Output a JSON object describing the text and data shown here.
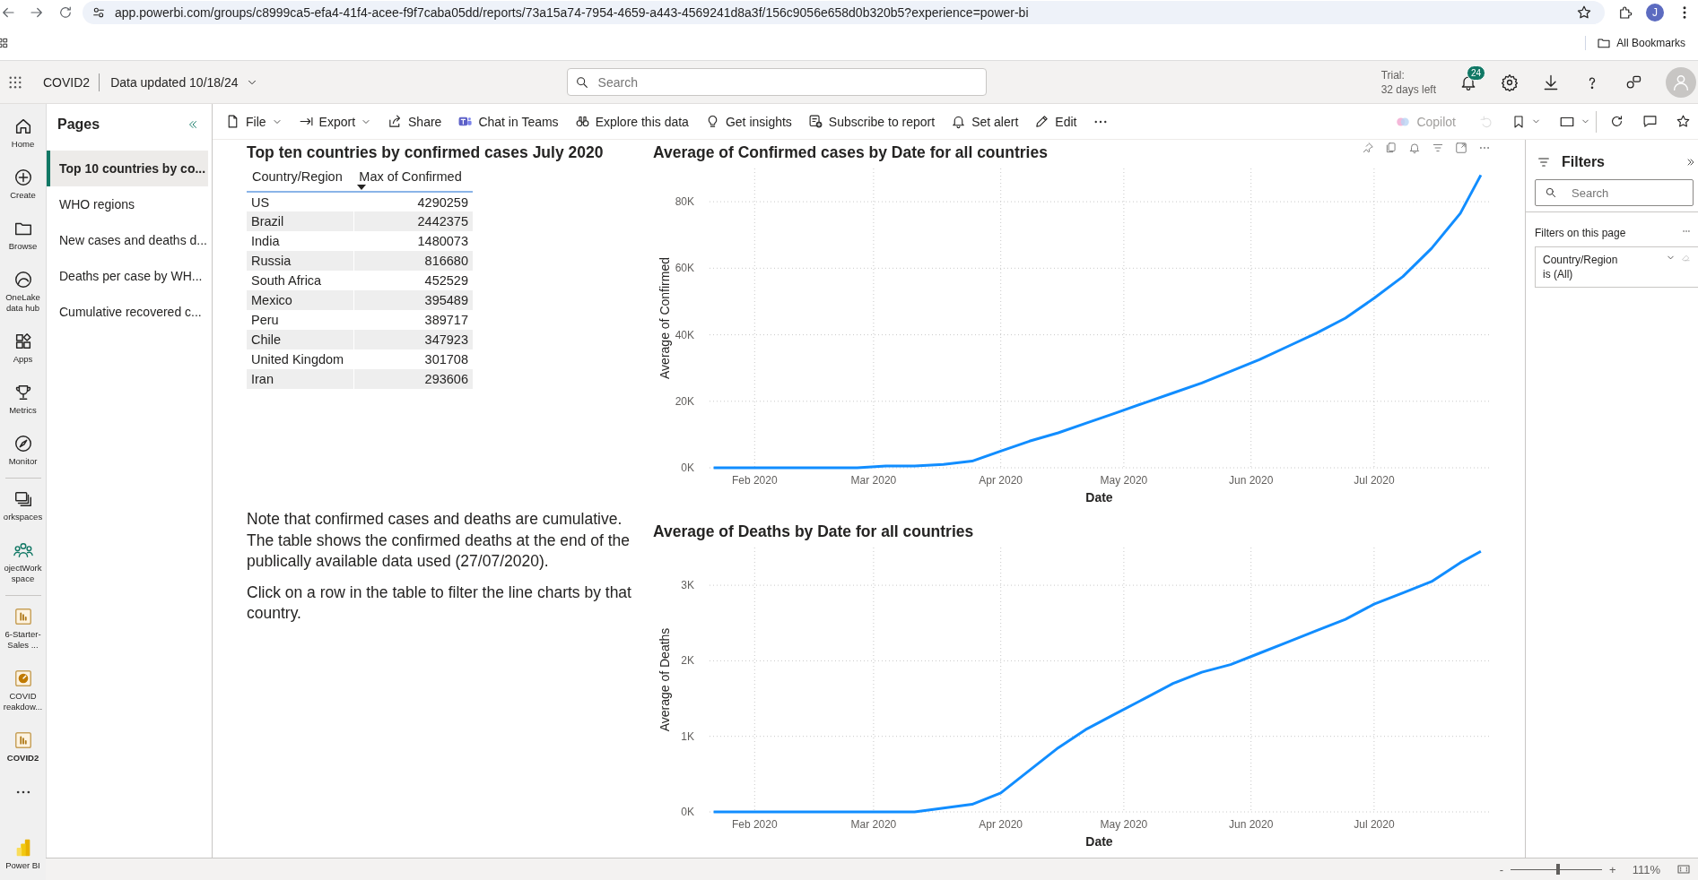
{
  "browser": {
    "url": "app.powerbi.com/groups/c8999ca5-efa4-41f4-acee-f9f7caba05dd/reports/73a15a74-7954-4659-a443-4569241d8a3f/156c9056e658d0b320b5?experience=power-bi",
    "profile_initial": "J",
    "bookmarks": "All Bookmarks"
  },
  "header": {
    "workspace": "COVID2",
    "data_updated": "Data updated 10/18/24",
    "search": {
      "placeholder": "Search"
    },
    "trial": "Trial:",
    "days_left": "32 days left",
    "notifications": "24"
  },
  "nav_rail": {
    "items": [
      {
        "label": "Home"
      },
      {
        "label": "Create"
      },
      {
        "label": "Browse"
      },
      {
        "label": "OneLake data hub"
      },
      {
        "label": "Apps"
      },
      {
        "label": "Metrics"
      },
      {
        "label": "Monitor"
      }
    ],
    "workspaces": [
      {
        "label": "orkspaces"
      },
      {
        "label": "ojectWork space"
      }
    ],
    "recent": [
      {
        "label": "6-Starter-Sales ...",
        "selected": false
      },
      {
        "label": "COVID reakdow...",
        "selected": false
      },
      {
        "label": "COVID2",
        "selected": true
      }
    ],
    "product": "Power BI"
  },
  "pages": {
    "title": "Pages",
    "items": [
      {
        "label": "Top 10 countries by co...",
        "selected": true
      },
      {
        "label": "WHO regions",
        "selected": false
      },
      {
        "label": "New cases and deaths d...",
        "selected": false
      },
      {
        "label": "Deaths per case by WH...",
        "selected": false
      },
      {
        "label": "Cumulative recovered c...",
        "selected": false
      }
    ]
  },
  "toolbar": {
    "items": [
      {
        "label": "File",
        "has_menu": true
      },
      {
        "label": "Export",
        "has_menu": true
      },
      {
        "label": "Share",
        "has_menu": false
      },
      {
        "label": "Chat in Teams",
        "has_menu": false
      },
      {
        "label": "Explore this data",
        "has_menu": false
      },
      {
        "label": "Get insights",
        "has_menu": false
      },
      {
        "label": "Subscribe to report",
        "has_menu": false
      },
      {
        "label": "Set alert",
        "has_menu": false
      },
      {
        "label": "Edit",
        "has_menu": false
      }
    ],
    "copilot": {
      "label": "Copilot",
      "disabled": true
    }
  },
  "table": {
    "title": "Top ten countries by confirmed cases July 2020",
    "columns": [
      {
        "label": "Country/Region",
        "sorted": false
      },
      {
        "label": "Max of Confirmed",
        "sorted": true
      }
    ],
    "rows": [
      [
        "US",
        "4290259"
      ],
      [
        "Brazil",
        "2442375"
      ],
      [
        "India",
        "1480073"
      ],
      [
        "Russia",
        "816680"
      ],
      [
        "South Africa",
        "452529"
      ],
      [
        "Mexico",
        "395489"
      ],
      [
        "Peru",
        "389717"
      ],
      [
        "Chile",
        "347923"
      ],
      [
        "United Kingdom",
        "301708"
      ],
      [
        "Iran",
        "293606"
      ]
    ]
  },
  "notes": [
    "Note that confirmed cases and deaths are cumulative. The table shows the confirmed deaths at the end of the publically available data used (27/07/2020).",
    "Click on a row in the table to filter the line charts by that country."
  ],
  "charts": [
    {
      "focused": true,
      "chart_data": {
        "type": "line",
        "title": "Average of Confirmed cases by Date for all countries",
        "xlabel": "Date",
        "ylabel": "Average of Confirmed",
        "x": [
          "2020-01-22",
          "2020-01-29",
          "2020-02-05",
          "2020-02-12",
          "2020-02-19",
          "2020-02-26",
          "2020-03-04",
          "2020-03-11",
          "2020-03-18",
          "2020-03-25",
          "2020-04-01",
          "2020-04-08",
          "2020-04-15",
          "2020-04-22",
          "2020-04-29",
          "2020-05-06",
          "2020-05-13",
          "2020-05-20",
          "2020-05-27",
          "2020-06-03",
          "2020-06-10",
          "2020-06-17",
          "2020-06-24",
          "2020-07-01",
          "2020-07-08",
          "2020-07-15",
          "2020-07-22",
          "2020-07-27"
        ],
        "grid": true,
        "series": [
          {
            "color": "#118dff",
            "values": [
              0,
              0,
              0,
              0,
              0,
              0,
              500,
              500,
              1000,
              2000,
              5000,
              8000,
              10500,
              13500,
              16500,
              19500,
              22500,
              25500,
              29000,
              32500,
              36500,
              40500,
              45000,
              51000,
              57500,
              66000,
              76500,
              88000
            ]
          }
        ],
        "xlim": [
          "2020-01-21",
          "2020-07-29"
        ],
        "ylim": [
          0,
          90000
        ],
        "xticks": [
          {
            "value": "2020-02-01",
            "label": "Feb 2020"
          },
          {
            "value": "2020-03-01",
            "label": "Mar 2020"
          },
          {
            "value": "2020-04-01",
            "label": "Apr 2020"
          },
          {
            "value": "2020-05-01",
            "label": "May 2020"
          },
          {
            "value": "2020-06-01",
            "label": "Jun 2020"
          },
          {
            "value": "2020-07-01",
            "label": "Jul 2020"
          }
        ],
        "yticks": [
          {
            "value": 0,
            "label": "0K"
          },
          {
            "value": 20000,
            "label": "20K"
          },
          {
            "value": 40000,
            "label": "40K"
          },
          {
            "value": 60000,
            "label": "60K"
          },
          {
            "value": 80000,
            "label": "80K"
          }
        ]
      }
    },
    {
      "focused": false,
      "chart_data": {
        "type": "line",
        "title": "Average of Deaths by Date for all countries",
        "xlabel": "Date",
        "ylabel": "Average of Deaths",
        "x": [
          "2020-01-22",
          "2020-01-29",
          "2020-02-05",
          "2020-02-12",
          "2020-02-19",
          "2020-02-26",
          "2020-03-04",
          "2020-03-11",
          "2020-03-18",
          "2020-03-25",
          "2020-04-01",
          "2020-04-08",
          "2020-04-15",
          "2020-04-22",
          "2020-04-29",
          "2020-05-06",
          "2020-05-13",
          "2020-05-20",
          "2020-05-27",
          "2020-06-03",
          "2020-06-10",
          "2020-06-17",
          "2020-06-24",
          "2020-07-01",
          "2020-07-08",
          "2020-07-15",
          "2020-07-22",
          "2020-07-27"
        ],
        "grid": true,
        "series": [
          {
            "color": "#118dff",
            "values": [
              0,
              0,
              0,
              0,
              0,
              0,
              0,
              0,
              50,
              100,
              250,
              550,
              850,
              1100,
              1300,
              1500,
              1700,
              1850,
              1950,
              2100,
              2250,
              2400,
              2550,
              2750,
              2900,
              3050,
              3300,
              3450
            ]
          }
        ],
        "xlim": [
          "2020-01-21",
          "2020-07-29"
        ],
        "ylim": [
          0,
          3500
        ],
        "xticks": [
          {
            "value": "2020-02-01",
            "label": "Feb 2020"
          },
          {
            "value": "2020-03-01",
            "label": "Mar 2020"
          },
          {
            "value": "2020-04-01",
            "label": "Apr 2020"
          },
          {
            "value": "2020-05-01",
            "label": "May 2020"
          },
          {
            "value": "2020-06-01",
            "label": "Jun 2020"
          },
          {
            "value": "2020-07-01",
            "label": "Jul 2020"
          }
        ],
        "yticks": [
          {
            "value": 0,
            "label": "0K"
          },
          {
            "value": 1000,
            "label": "1K"
          },
          {
            "value": 2000,
            "label": "2K"
          },
          {
            "value": 3000,
            "label": "3K"
          }
        ]
      }
    }
  ],
  "filters": {
    "title": "Filters",
    "search": {
      "placeholder": "Search"
    },
    "section": "Filters on this page",
    "cards": [
      {
        "field": "Country/Region",
        "condition": "is (All)"
      }
    ]
  },
  "footer": {
    "minus": "-",
    "plus": "+",
    "level": 0.52,
    "zoom": "111%"
  }
}
